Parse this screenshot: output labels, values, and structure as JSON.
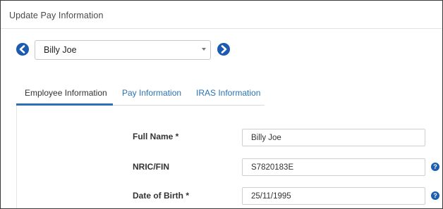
{
  "header": {
    "title": "Update Pay Information"
  },
  "employee_selector": {
    "selected": "Billy Joe",
    "prev_icon": "arrow-left-circle-icon",
    "next_icon": "arrow-right-circle-icon"
  },
  "tabs": [
    {
      "label": "Employee Information",
      "active": true
    },
    {
      "label": "Pay Information",
      "active": false
    },
    {
      "label": "IRAS Information",
      "active": false
    }
  ],
  "form": {
    "fields": [
      {
        "label": "Full Name *",
        "value": "Billy Joe",
        "help": false
      },
      {
        "label": "NRIC/FIN",
        "value": "S7820183E",
        "help": true
      },
      {
        "label": "Date of Birth *",
        "value": "25/11/1995",
        "help": true
      }
    ],
    "help_glyph": "?"
  },
  "colors": {
    "accent": "#1b5cb1",
    "tab_link": "#2a72b5",
    "label_text": "#333333"
  }
}
